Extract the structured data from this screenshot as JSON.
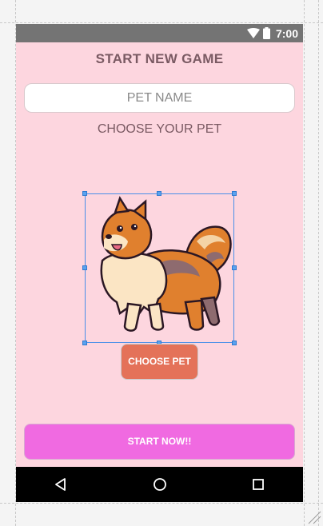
{
  "status_bar": {
    "time": "7:00"
  },
  "screen": {
    "title": "START NEW GAME",
    "pet_name_input": {
      "placeholder": "PET NAME",
      "value": ""
    },
    "choose_pet_label": "CHOOSE YOUR PET",
    "pet_image": {
      "description": "pomeranian-dog"
    },
    "choose_pet_button": "CHOOSE PET",
    "start_button": "START NOW!!"
  },
  "nav_bar": {
    "buttons": [
      "back-icon",
      "home-icon",
      "recents-icon"
    ]
  },
  "colors": {
    "background": "#fdd6df",
    "title_text": "#7a5a63",
    "choose_button": "#e47259",
    "start_button": "#f06ae1",
    "status_bar": "#747474",
    "selection": "#4a8fe8"
  }
}
